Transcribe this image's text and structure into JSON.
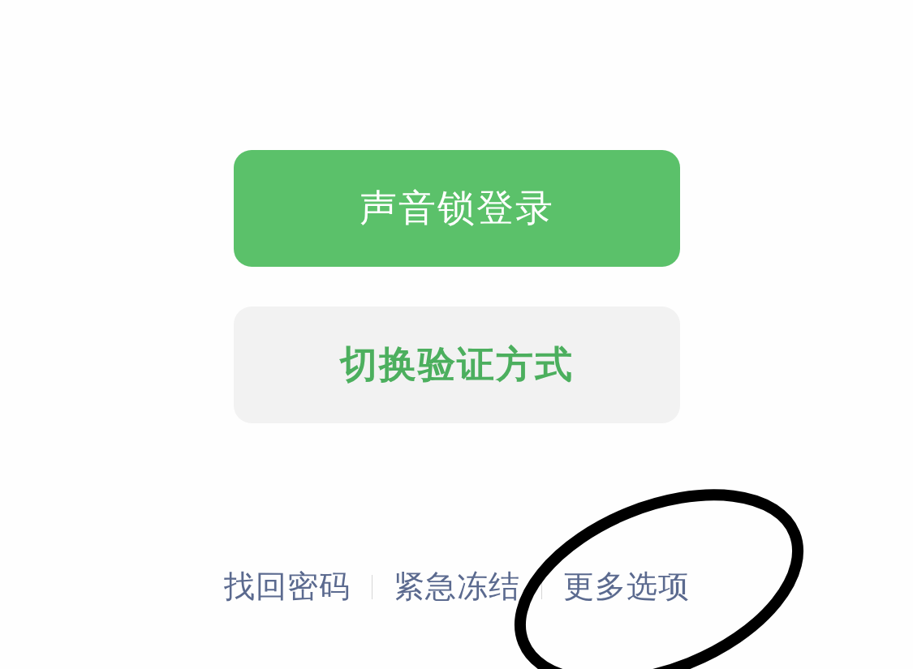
{
  "buttons": [
    {
      "label": "声音锁登录",
      "kind": "primary"
    },
    {
      "label": "切换验证方式",
      "kind": "secondary"
    }
  ],
  "links": [
    "找回密码",
    "紧急冻结",
    "更多选项"
  ]
}
